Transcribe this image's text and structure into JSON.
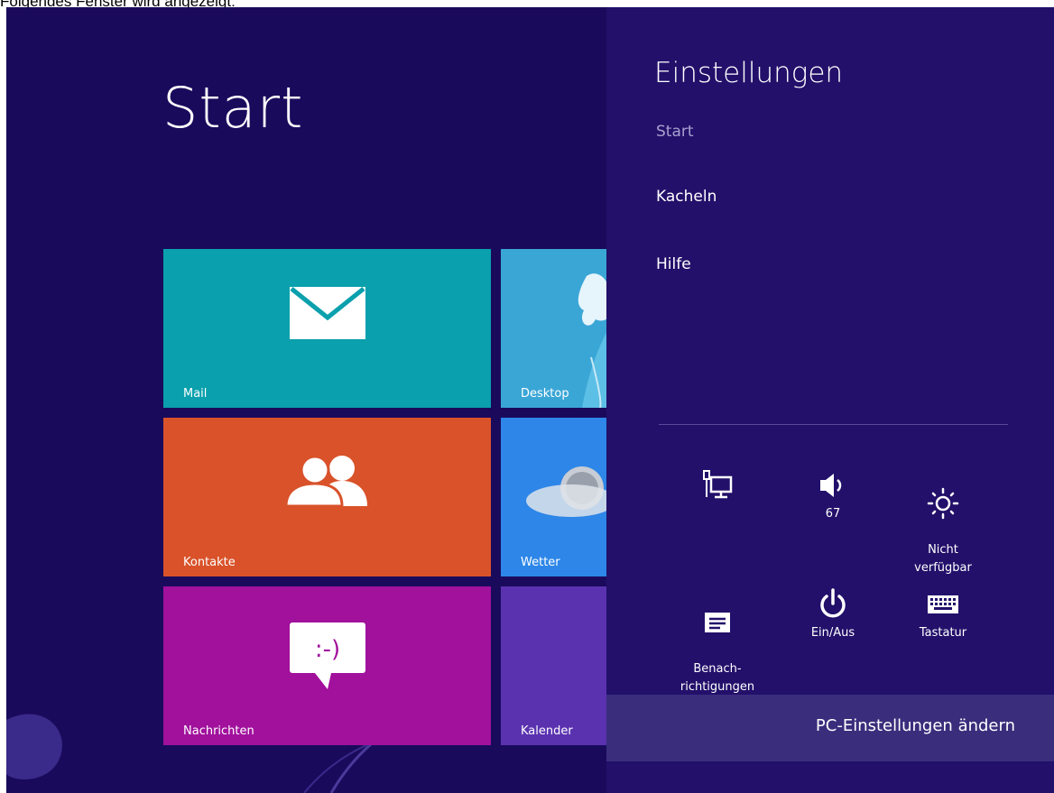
{
  "caption": "Folgendes Fenster wird angezeigt:",
  "start": {
    "title": "Start"
  },
  "tiles": [
    {
      "label": "Mail",
      "icon": "envelope-icon",
      "color": "#0aa0ad"
    },
    {
      "label": "Desktop",
      "icon": "desktop-wallpaper",
      "color": "#3aa6d6"
    },
    {
      "label": "Kontakte",
      "icon": "people-icon",
      "color": "#d9522a"
    },
    {
      "label": "Wetter",
      "icon": "cloud-icon",
      "color": "#2d86e8"
    },
    {
      "label": "Nachrichten",
      "icon": "chat-smiley-icon",
      "color": "#a1119c",
      "smiley": ":-)"
    },
    {
      "label": "Kalender",
      "icon": "calendar-icon",
      "color": "#5a32b0"
    }
  ],
  "charm": {
    "title": "Einstellungen",
    "items": [
      "Start",
      "Kacheln",
      "Hilfe"
    ],
    "quick_settings": [
      {
        "icon": "network-icon",
        "label": ""
      },
      {
        "icon": "volume-icon",
        "label": "67"
      },
      {
        "icon": "brightness-icon",
        "label": "Nicht\nverfügbar"
      },
      {
        "icon": "notifications-icon",
        "label": "Benach-\nrichtigungen"
      },
      {
        "icon": "power-icon",
        "label": "Ein/Aus"
      },
      {
        "icon": "keyboard-icon",
        "label": "Tastatur"
      }
    ],
    "pc_settings": "PC-Einstellungen ändern"
  },
  "colors": {
    "background": "#1a0a5c",
    "charm": "#22106a",
    "bottom_bar": "#3a2d7c"
  }
}
